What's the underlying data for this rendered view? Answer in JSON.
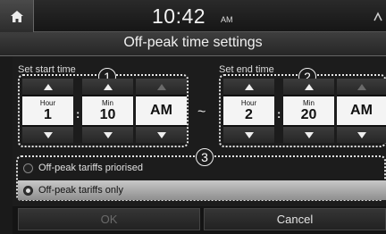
{
  "status_bar": {
    "time": "10:42",
    "ampm": "AM",
    "home_icon": "home-icon",
    "signal_icon": "signal-icon"
  },
  "dialog": {
    "title": "Off-peak time settings"
  },
  "start_time": {
    "label": "Set start time",
    "callout": "1",
    "hour": {
      "caption": "Hour",
      "value": "1"
    },
    "minute": {
      "caption": "Min",
      "value": "10"
    },
    "period": "AM",
    "separator": ":"
  },
  "range_separator": "~",
  "end_time": {
    "label": "Set end time",
    "callout": "2",
    "hour": {
      "caption": "Hour",
      "value": "2"
    },
    "minute": {
      "caption": "Min",
      "value": "20"
    },
    "period": "AM",
    "separator": ":"
  },
  "options": {
    "callout": "3",
    "items": [
      {
        "label": "Off-peak tariffs priorised",
        "selected": false
      },
      {
        "label": "Off-peak tariffs only",
        "selected": true
      }
    ]
  },
  "buttons": {
    "ok": "OK",
    "cancel": "Cancel",
    "ok_enabled": false
  },
  "colors": {
    "background": "#1a1a1a",
    "value_box": "#f4f4f4",
    "selected_row": "#b0b0b0",
    "disabled_text": "#6a6a6a"
  }
}
